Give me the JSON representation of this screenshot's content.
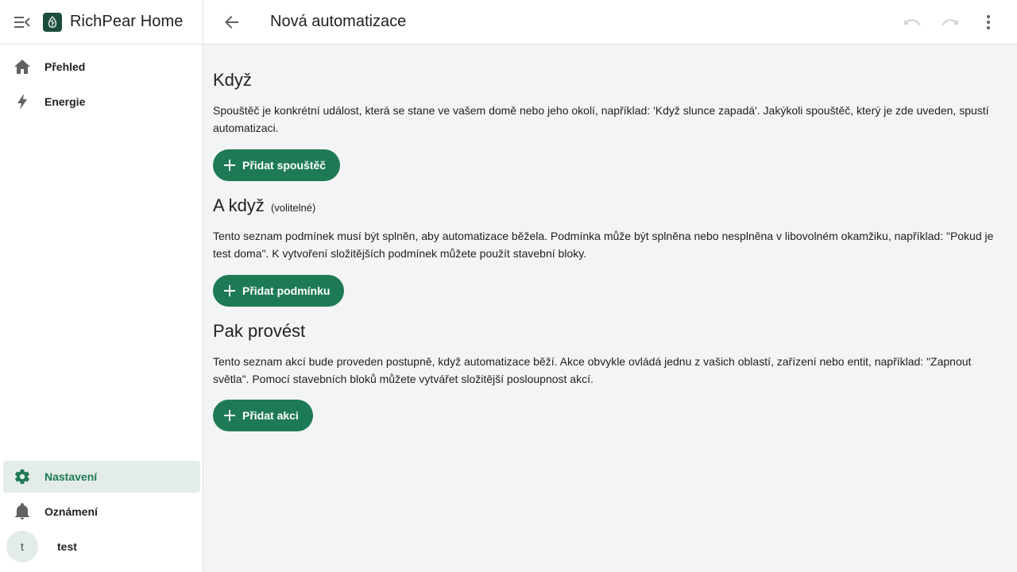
{
  "app": {
    "title": "RichPear Home"
  },
  "sidebar": {
    "items": [
      {
        "label": "Přehled",
        "icon": "home-icon"
      },
      {
        "label": "Energie",
        "icon": "lightning-icon"
      }
    ],
    "bottom_items": [
      {
        "label": "Nastavení",
        "icon": "gear-icon",
        "active": true
      },
      {
        "label": "Oznámení",
        "icon": "bell-icon"
      }
    ],
    "user": {
      "initial": "t",
      "name": "test"
    }
  },
  "header": {
    "title": "Nová automatizace"
  },
  "sections": {
    "when": {
      "title": "Když",
      "description": "Spouštěč je konkrétní událost, která se stane ve vašem domě nebo jeho okolí, například: 'Když slunce zapadá'. Jakýkoli spouštěč, který je zde uveden, spustí automatizaci.",
      "button": "Přidat spouštěč"
    },
    "and_if": {
      "title": "A když",
      "optional": "(volitelné)",
      "description": "Tento seznam podmínek musí být splněn, aby automatizace běžela. Podmínka může být splněna nebo nesplněna v libovolném okamžiku, například: \"Pokud je test doma\". K vytvoření složitějších podmínek můžete použít stavební bloky.",
      "button": "Přidat podmínku"
    },
    "then_do": {
      "title": "Pak provést",
      "description": "Tento seznam akcí bude proveden postupně, když automatizace běží. Akce obvykle ovládá jednu z vašich oblastí, zařízení nebo entit, například: \"Zapnout světla\". Pomocí stavebních bloků můžete vytvářet složitější posloupnost akcí.",
      "button": "Přidat akci"
    }
  },
  "colors": {
    "accent": "#1e7a55",
    "active_bg": "#e3ece8",
    "background": "#f3f4f5"
  }
}
